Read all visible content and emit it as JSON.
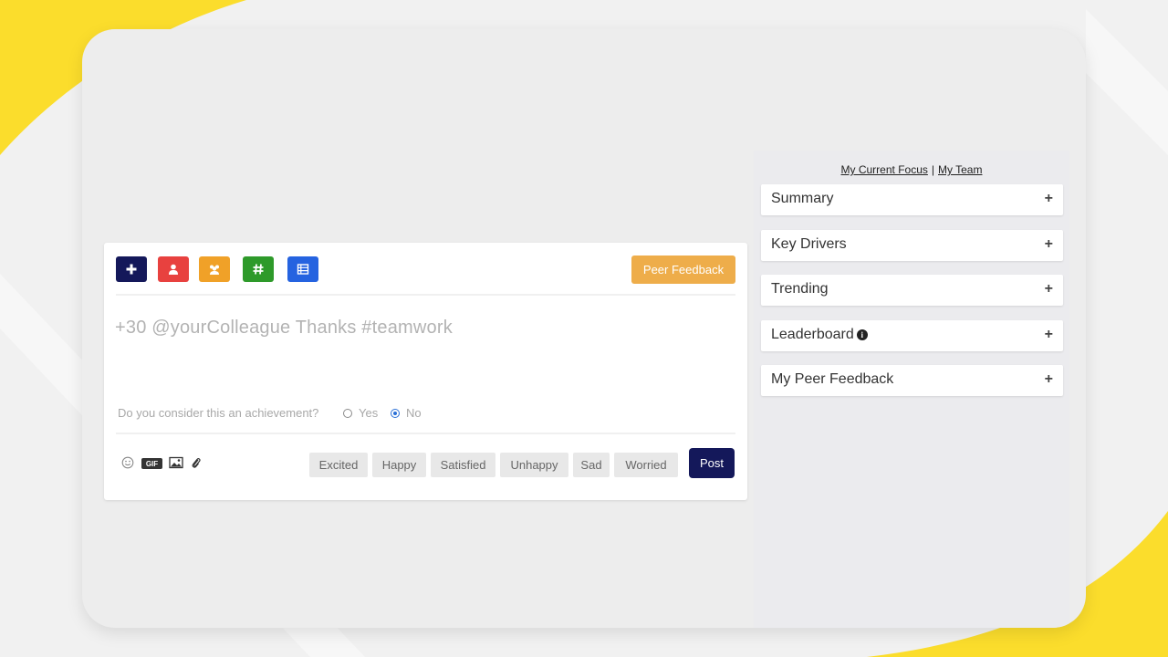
{
  "toolbar": {
    "buttons": [
      {
        "icon": "plus-icon",
        "color": "#14185a"
      },
      {
        "icon": "user-icon",
        "color": "#e8413f"
      },
      {
        "icon": "group-icon",
        "color": "#f0a128"
      },
      {
        "icon": "hashtag-icon",
        "color": "#2e9a2a"
      },
      {
        "icon": "list-icon",
        "color": "#2563e0"
      }
    ],
    "peer_feedback_label": "Peer Feedback",
    "peer_feedback_color": "#eead4a"
  },
  "composer": {
    "placeholder": "+30 @yourColleague Thanks #teamwork",
    "question": "Do you consider this an achievement?",
    "options": {
      "yes": "Yes",
      "no": "No",
      "selected": "No"
    },
    "attachments": [
      "smiley-icon",
      "gif-icon",
      "image-icon",
      "paperclip-icon"
    ],
    "gif_label": "GIF",
    "moods": [
      "Excited",
      "Happy",
      "Satisfied",
      "Unhappy",
      "Sad",
      "Worried"
    ],
    "post_label": "Post"
  },
  "sidebar": {
    "links": {
      "current_focus": "My Current Focus",
      "separator": "|",
      "team": "My Team"
    },
    "panels": [
      {
        "title": "Summary",
        "toggle": "+"
      },
      {
        "title": "Key Drivers",
        "toggle": "+"
      },
      {
        "title": "Trending",
        "toggle": "+"
      },
      {
        "title": "Leaderboard",
        "toggle": "+",
        "info_icon": "i"
      },
      {
        "title": "My Peer Feedback",
        "toggle": "+"
      }
    ]
  },
  "colors": {
    "accent_yellow": "#fbdd2c",
    "post": "#14185a",
    "radio": "#2a6fd6"
  }
}
